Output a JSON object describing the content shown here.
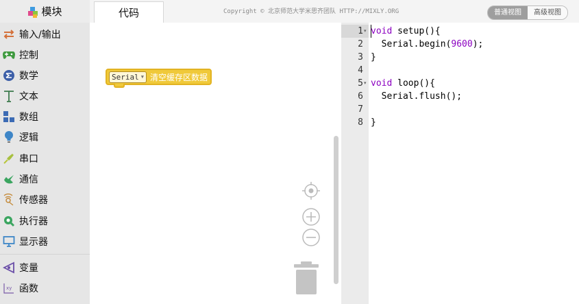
{
  "header": {
    "modules_label": "模块",
    "code_tab": "代码",
    "copyright": "Copyright © 北京师范大学米思齐团队 HTTP://MIXLY.ORG",
    "normal_view": "普通视图",
    "advanced_view": "高级视图"
  },
  "sidebar": {
    "items": [
      {
        "label": "输入/输出",
        "icon": "io-arrows-icon",
        "color": "#d4713b"
      },
      {
        "label": "控制",
        "icon": "gamepad-icon",
        "color": "#3f9a3f"
      },
      {
        "label": "数学",
        "icon": "math-icon",
        "color": "#3d5fa8"
      },
      {
        "label": "文本",
        "icon": "text-t-icon",
        "color": "#3c7a4c"
      },
      {
        "label": "数组",
        "icon": "array-icon",
        "color": "#3c6bb4"
      },
      {
        "label": "逻辑",
        "icon": "lightbulb-icon",
        "color": "#3e86c7"
      },
      {
        "label": "串口",
        "icon": "serial-plug-icon",
        "color": "#a8c040"
      },
      {
        "label": "通信",
        "icon": "communication-icon",
        "color": "#3ba560"
      },
      {
        "label": "传感器",
        "icon": "sensor-icon",
        "color": "#c48a3a"
      },
      {
        "label": "执行器",
        "icon": "actuator-icon",
        "color": "#3ba560"
      },
      {
        "label": "显示器",
        "icon": "monitor-icon",
        "color": "#3d86c7"
      },
      {
        "label": "变量",
        "icon": "variable-icon",
        "color": "#6a4ea8"
      },
      {
        "label": "函数",
        "icon": "function-icon",
        "color": "#7a5aa8"
      }
    ]
  },
  "workspace": {
    "block": {
      "dropdown": "Serial",
      "label": "清空缓存区数据"
    }
  },
  "editor": {
    "lines": [
      {
        "num": "1",
        "fold": true,
        "parts": [
          {
            "t": "void",
            "c": "kw"
          },
          {
            "t": " setup(){",
            "c": ""
          }
        ]
      },
      {
        "num": "2",
        "fold": false,
        "parts": [
          {
            "t": "  Serial.begin(",
            "c": ""
          },
          {
            "t": "9600",
            "c": "num"
          },
          {
            "t": ");",
            "c": ""
          }
        ]
      },
      {
        "num": "3",
        "fold": false,
        "parts": [
          {
            "t": "}",
            "c": ""
          }
        ]
      },
      {
        "num": "4",
        "fold": false,
        "parts": []
      },
      {
        "num": "5",
        "fold": true,
        "parts": [
          {
            "t": "void",
            "c": "kw"
          },
          {
            "t": " loop(){",
            "c": ""
          }
        ]
      },
      {
        "num": "6",
        "fold": false,
        "parts": [
          {
            "t": "  Serial.flush();",
            "c": ""
          }
        ]
      },
      {
        "num": "7",
        "fold": false,
        "parts": []
      },
      {
        "num": "8",
        "fold": false,
        "parts": [
          {
            "t": "}",
            "c": ""
          }
        ]
      }
    ]
  }
}
